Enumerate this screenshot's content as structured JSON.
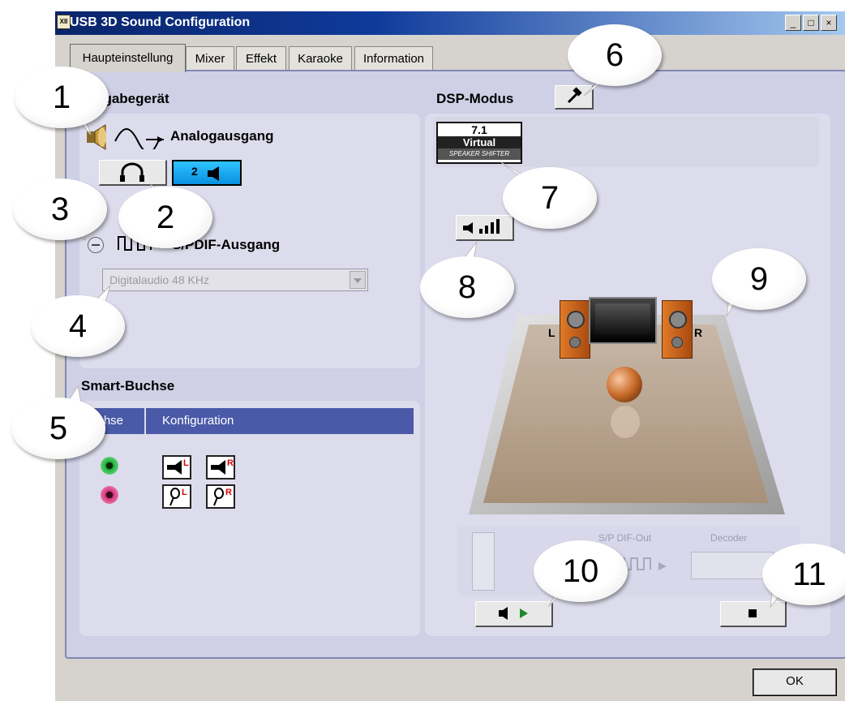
{
  "window": {
    "title": "USB 3D Sound Configuration",
    "controls": [
      "_",
      "□",
      "×"
    ]
  },
  "tabs": [
    {
      "label": "Haupteinstellung",
      "active": true
    },
    {
      "label": "Mixer",
      "active": false
    },
    {
      "label": "Effekt",
      "active": false
    },
    {
      "label": "Karaoke",
      "active": false
    },
    {
      "label": "Information",
      "active": false
    }
  ],
  "output": {
    "heading_partial": "sgabegerät",
    "analog_label": "Analogausgang",
    "speaker_button_label": "2",
    "spdif_label_partial": "S/PDIF-Ausgang",
    "spdif_select_value": "Digitalaudio  48 KHz"
  },
  "smart_jack": {
    "heading": "Smart-Buchse",
    "col_jack_partial": "uchse",
    "col_config": "Konfiguration",
    "rows": [
      {
        "jack_color": "#1fae3a",
        "config": [
          "speaker-L",
          "speaker-R"
        ],
        "marks": [
          "L",
          "R"
        ]
      },
      {
        "jack_color": "#d2357a",
        "config": [
          "mic-L",
          "mic-R"
        ],
        "marks": [
          "L",
          "R"
        ]
      }
    ]
  },
  "dsp": {
    "heading": "DSP-Modus",
    "virtual_badge": {
      "line1": "7.1",
      "line2": "Virtual",
      "line3": "SPEAKER SHIFTER"
    },
    "room_left_label": "L",
    "room_right_label": "R",
    "spdif_out_label": "S/P DIF-Out",
    "decoder_label": "Decoder"
  },
  "buttons": {
    "ok": "OK"
  },
  "callouts": [
    "1",
    "2",
    "3",
    "4",
    "5",
    "6",
    "7",
    "8",
    "9",
    "10",
    "11"
  ],
  "colors": {
    "title_bar": "#0a246a",
    "panel": "#cfd0e6",
    "header_blue": "#4a5aa8",
    "callout": "#ffffff"
  }
}
